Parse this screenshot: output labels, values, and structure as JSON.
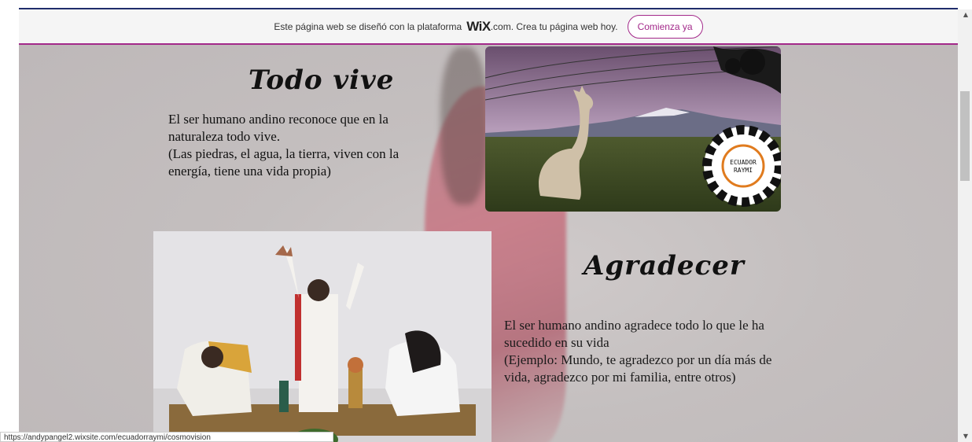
{
  "wix_banner": {
    "text_before": "Este página web se diseñó con la plataforma",
    "logo": "WiX",
    "text_after": ".com. Crea tu página web hoy.",
    "button_label": "Comienza ya",
    "accent_color": "#a3298a"
  },
  "sections": [
    {
      "title": "Todo vive",
      "body_lines": [
        "El ser humano andino reconoce que en la",
        "naturaleza todo vive.",
        "(Las piedras, el agua, la tierra, viven con la",
        "energía, tiene una vida propia)"
      ]
    },
    {
      "title": "Agradecer",
      "body_lines": [
        "El ser humano andino agradece todo lo que le ha",
        "sucedido en su vida",
        "(Ejemplo: Mundo, te agradezco por un día más de",
        "vida, agradezco por mi familia, entre otros)"
      ]
    }
  ],
  "logo_badge": {
    "line1": "ECUADOR",
    "line2": "RAYMI"
  },
  "status_url": "https://andypangel2.wixsite.com/ecuadorraymi/cosmovision",
  "scrollbar": {
    "up_icon": "▲",
    "down_icon": "▼"
  }
}
